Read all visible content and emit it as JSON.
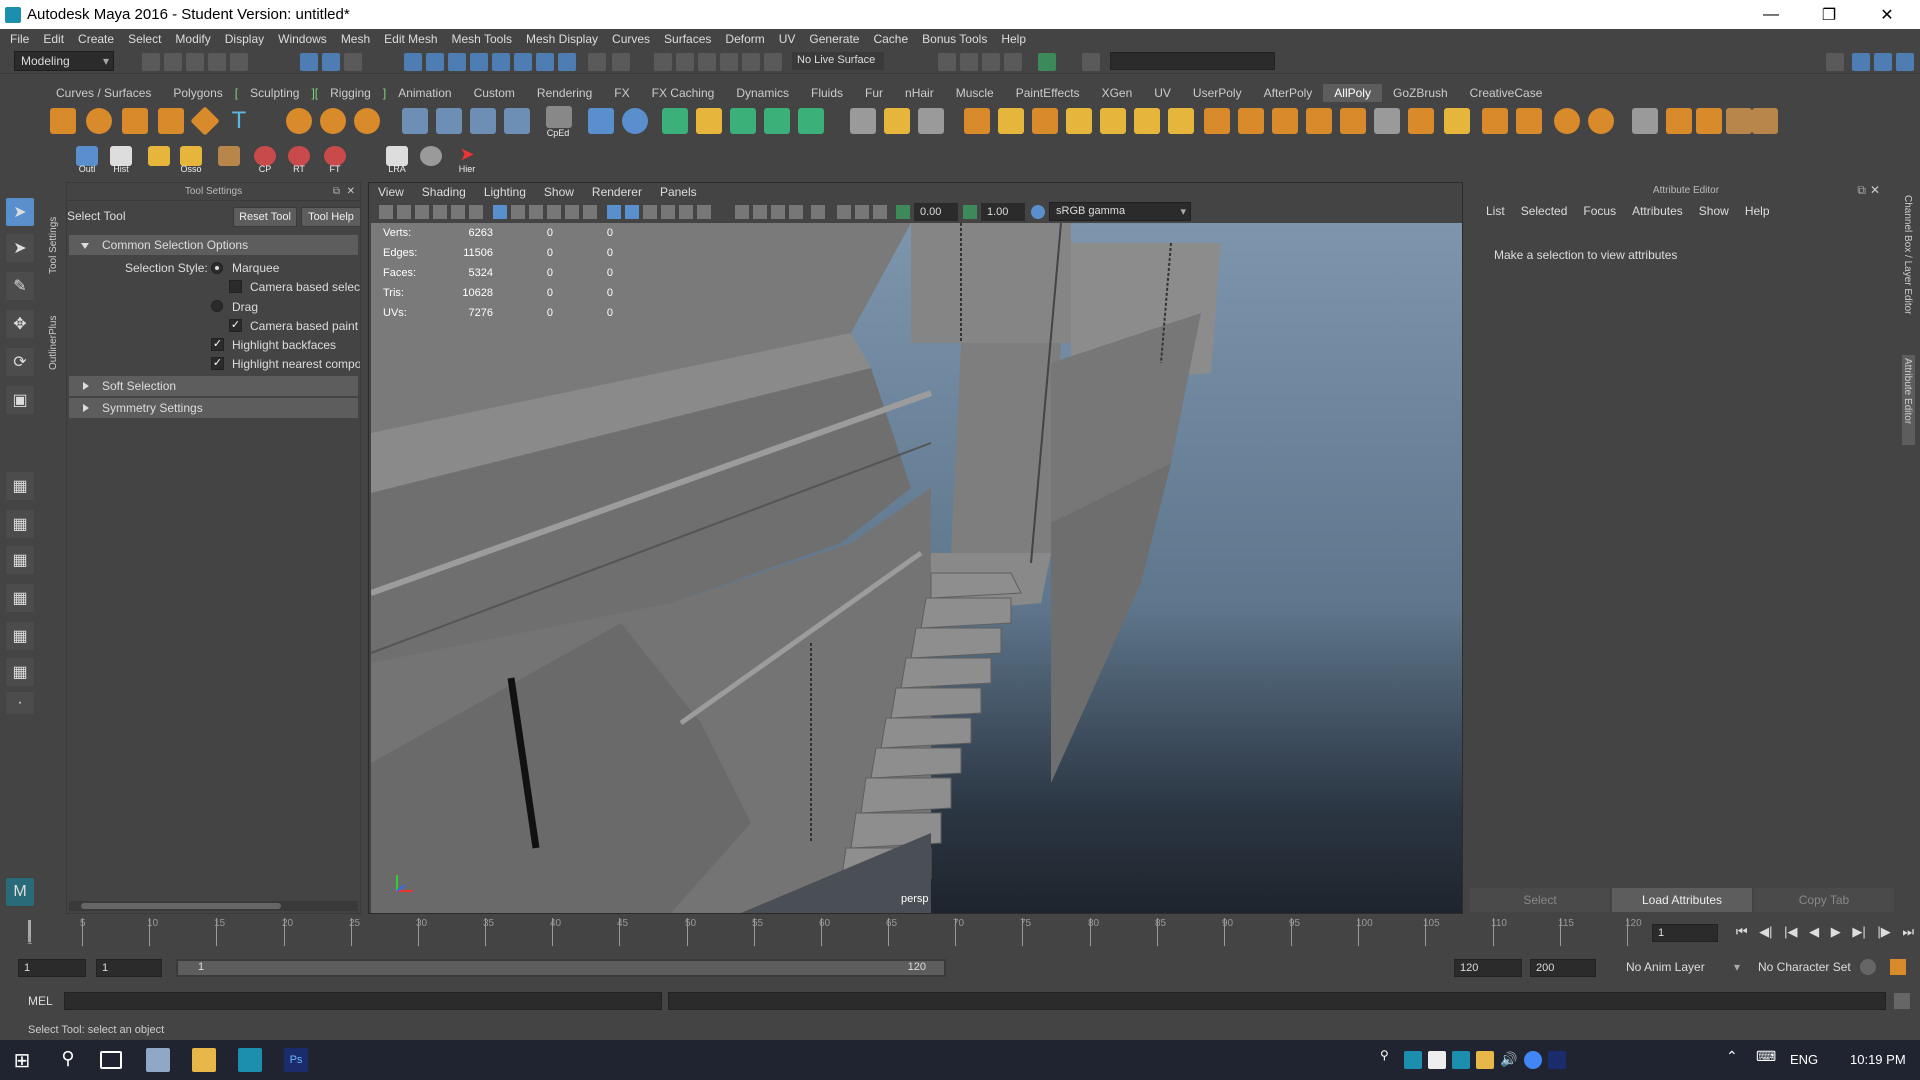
{
  "window": {
    "title": "Autodesk Maya 2016 - Student Version: untitled*"
  },
  "menubar": [
    "File",
    "Edit",
    "Create",
    "Select",
    "Modify",
    "Display",
    "Windows",
    "Mesh",
    "Edit Mesh",
    "Mesh Tools",
    "Mesh Display",
    "Curves",
    "Surfaces",
    "Deform",
    "UV",
    "Generate",
    "Cache",
    "Bonus Tools",
    "Help"
  ],
  "statusline": {
    "mode": "Modeling",
    "live_surface": "No Live Surface"
  },
  "shelf_tabs": [
    "Curves / Surfaces",
    "Polygons",
    "Sculpting",
    "Rigging",
    "Animation",
    "Custom",
    "Rendering",
    "FX",
    "FX Caching",
    "Dynamics",
    "Fluids",
    "Fur",
    "nHair",
    "Muscle",
    "PaintEffects",
    "XGen",
    "UV",
    "UserPoly",
    "AfterPoly",
    "AllPoly",
    "GoZBrush",
    "CreativeCase"
  ],
  "shelf_active": "AllPoly",
  "shelf_labels": {
    "cped": "CpEd",
    "outl": "Outl",
    "hist": "Hist",
    "osso": "Osso",
    "cp": "CP",
    "rt": "RT",
    "ft": "FT",
    "lra": "LRA",
    "hier": "Hier"
  },
  "side_tabs": {
    "tool_settings": "Tool Settings",
    "outliner_plus": "OutlinerPlus",
    "channel_box": "Channel Box / Layer Editor",
    "attribute_editor": "Attribute Editor"
  },
  "tool_settings": {
    "panel_title": "Tool Settings",
    "tool_name": "Select Tool",
    "reset_button": "Reset Tool",
    "help_button": "Tool Help",
    "common_section": "Common Selection Options",
    "selection_style_label": "Selection Style:",
    "marquee": "Marquee",
    "camera_based_selection": "Camera based selecti",
    "drag": "Drag",
    "camera_based_paint": "Camera based paint s",
    "highlight_backfaces": "Highlight backfaces",
    "highlight_nearest": "Highlight nearest compo",
    "soft_selection": "Soft Selection",
    "symmetry_settings": "Symmetry Settings"
  },
  "viewport": {
    "menu": [
      "View",
      "Shading",
      "Lighting",
      "Show",
      "Renderer",
      "Panels"
    ],
    "exposure": "0.00",
    "gamma": "1.00",
    "color_space": "sRGB gamma",
    "camera": "persp",
    "hud": [
      {
        "label": "Verts:",
        "value": "6263",
        "a": "0",
        "b": "0"
      },
      {
        "label": "Edges:",
        "value": "11506",
        "a": "0",
        "b": "0"
      },
      {
        "label": "Faces:",
        "value": "5324",
        "a": "0",
        "b": "0"
      },
      {
        "label": "Tris:",
        "value": "10628",
        "a": "0",
        "b": "0"
      },
      {
        "label": "UVs:",
        "value": "7276",
        "a": "0",
        "b": "0"
      }
    ]
  },
  "attribute_editor": {
    "title": "Attribute Editor",
    "menu": [
      "List",
      "Selected",
      "Focus",
      "Attributes",
      "Show",
      "Help"
    ],
    "message": "Make a selection to view attributes",
    "select_btn": "Select",
    "load_btn": "Load Attributes",
    "copy_btn": "Copy Tab"
  },
  "timeline": {
    "ticks": [
      "5",
      "10",
      "15",
      "20",
      "25",
      "30",
      "35",
      "40",
      "45",
      "50",
      "55",
      "60",
      "65",
      "70",
      "75",
      "80",
      "85",
      "90",
      "95",
      "100",
      "105",
      "110",
      "115",
      "120"
    ],
    "start_marker": "1",
    "current_frame": "1"
  },
  "range": {
    "start": "1",
    "inner_start": "1",
    "slider_start": "1",
    "slider_end": "120",
    "end": "120",
    "max": "200",
    "anim_layer": "No Anim Layer",
    "character_set": "No Character Set"
  },
  "command_line": {
    "label": "MEL"
  },
  "help_line": "Select Tool: select an object",
  "taskbar": {
    "lang": "ENG",
    "time": "10:19 PM"
  }
}
